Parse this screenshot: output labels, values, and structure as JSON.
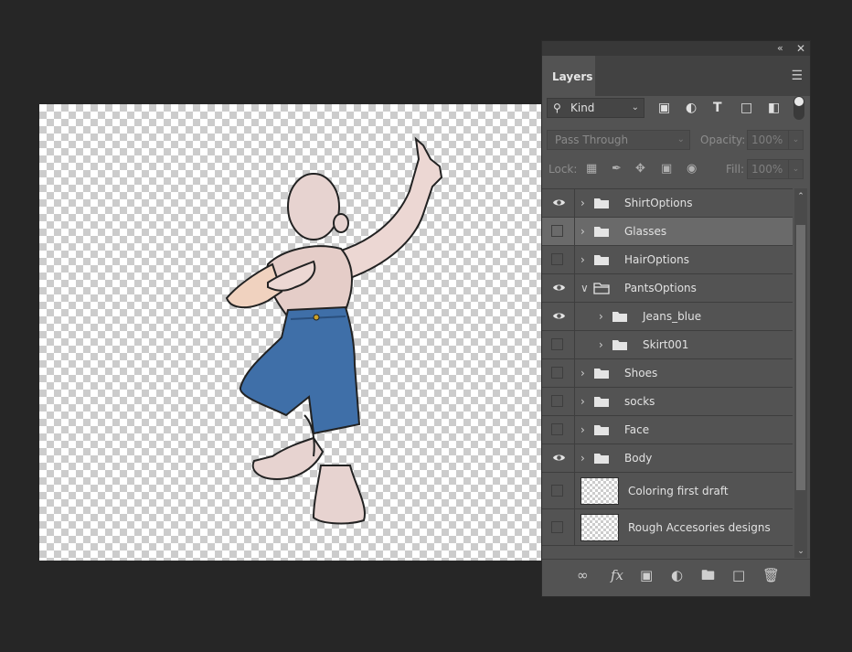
{
  "panel": {
    "tab_label": "Layers",
    "filter": {
      "kind_label": "Kind"
    },
    "blend_mode": "Pass Through",
    "opacity_label": "Opacity:",
    "opacity_value": "100%",
    "lock_label": "Lock:",
    "fill_label": "Fill:",
    "fill_value": "100%"
  },
  "layers": [
    {
      "name": "ShirtOptions",
      "visible": true,
      "type": "group",
      "expanded": false,
      "indent": 0,
      "selected": false
    },
    {
      "name": "Glasses",
      "visible": false,
      "type": "group",
      "expanded": false,
      "indent": 0,
      "selected": true
    },
    {
      "name": "HairOptions",
      "visible": false,
      "type": "group",
      "expanded": false,
      "indent": 0,
      "selected": false
    },
    {
      "name": "PantsOptions",
      "visible": true,
      "type": "group",
      "expanded": true,
      "indent": 0,
      "selected": false
    },
    {
      "name": "Jeans_blue",
      "visible": true,
      "type": "group",
      "expanded": false,
      "indent": 1,
      "selected": false
    },
    {
      "name": "Skirt001",
      "visible": false,
      "type": "group",
      "expanded": false,
      "indent": 1,
      "selected": false
    },
    {
      "name": "Shoes",
      "visible": false,
      "type": "group",
      "expanded": false,
      "indent": 0,
      "selected": false
    },
    {
      "name": "socks",
      "visible": false,
      "type": "group",
      "expanded": false,
      "indent": 0,
      "selected": false
    },
    {
      "name": "Face",
      "visible": false,
      "type": "group",
      "expanded": false,
      "indent": 0,
      "selected": false
    },
    {
      "name": "Body",
      "visible": true,
      "type": "group",
      "expanded": false,
      "indent": 0,
      "selected": false
    },
    {
      "name": "Coloring first draft",
      "visible": false,
      "type": "layer",
      "indent": 0,
      "selected": false
    },
    {
      "name": "Rough Accesories designs",
      "visible": false,
      "type": "layer",
      "indent": 0,
      "selected": false
    }
  ]
}
